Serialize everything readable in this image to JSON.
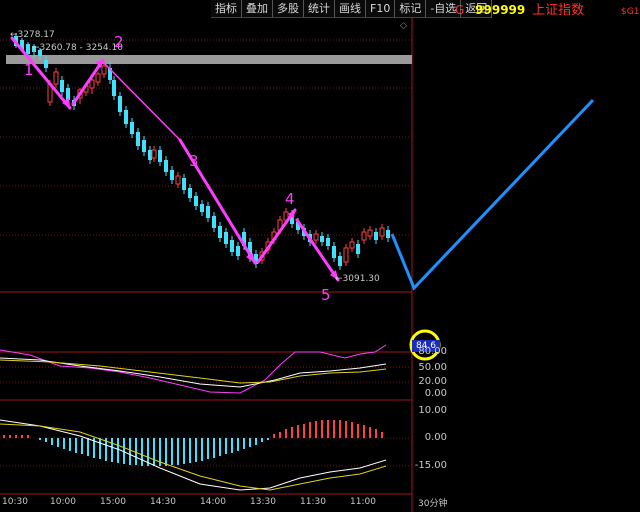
{
  "toolbar": {
    "buttons": [
      "指标",
      "叠加",
      "多股",
      "统计",
      "画线",
      "F10",
      "标记",
      "-自选",
      "返回"
    ]
  },
  "ticker": {
    "prefix": "G",
    "code": "999999",
    "name": "上证指数",
    "tag": "$G1"
  },
  "price_labels": {
    "high": "3278.17",
    "range": "3260.78 - 3254.10",
    "low": "3091.30"
  },
  "wave_marks": [
    "1",
    "2",
    "3",
    "4",
    "5"
  ],
  "indicator1": {
    "current": "84.6",
    "levels": [
      "80.00",
      "50.00",
      "20.00",
      "0.00"
    ]
  },
  "indicator2": {
    "levels": [
      "10.00",
      "0.00",
      "-15.00"
    ]
  },
  "time_axis": {
    "ticks": [
      "10:30",
      "10:00",
      "15:00",
      "14:30",
      "14:00",
      "13:30",
      "11:30",
      "11:00"
    ],
    "period": "30分钟"
  },
  "colors": {
    "up": "#ff4040",
    "down": "#40e0ff",
    "wave": "#ff3cff",
    "projection": "#1e90ff",
    "highlight": "#ffff00"
  }
}
